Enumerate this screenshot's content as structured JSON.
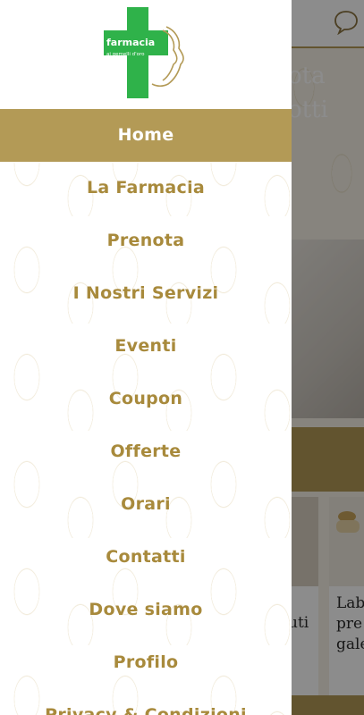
{
  "brand": {
    "logo_title": "farmacia",
    "logo_subtitle": "ai gemelli d'oro",
    "green": "#2fb24a",
    "gold": "#b39a56"
  },
  "menu": {
    "items": [
      {
        "label": "Home",
        "active": true
      },
      {
        "label": "La Farmacia"
      },
      {
        "label": "Prenota"
      },
      {
        "label": "I Nostri Servizi"
      },
      {
        "label": "Eventi"
      },
      {
        "label": "Coupon"
      },
      {
        "label": "Offerte"
      },
      {
        "label": "Orari"
      },
      {
        "label": "Contatti"
      },
      {
        "label": "Dove siamo"
      },
      {
        "label": "Profilo"
      },
      {
        "label": "Privacy & Condizioni"
      }
    ]
  },
  "background": {
    "hero_text_line1": "ota",
    "hero_text_line2": "otti",
    "card1_text": "uti",
    "card2_line1": "Lab",
    "card2_line2": "pre",
    "card2_line3": "gale",
    "chat_icon": "chat-bubble-icon"
  }
}
